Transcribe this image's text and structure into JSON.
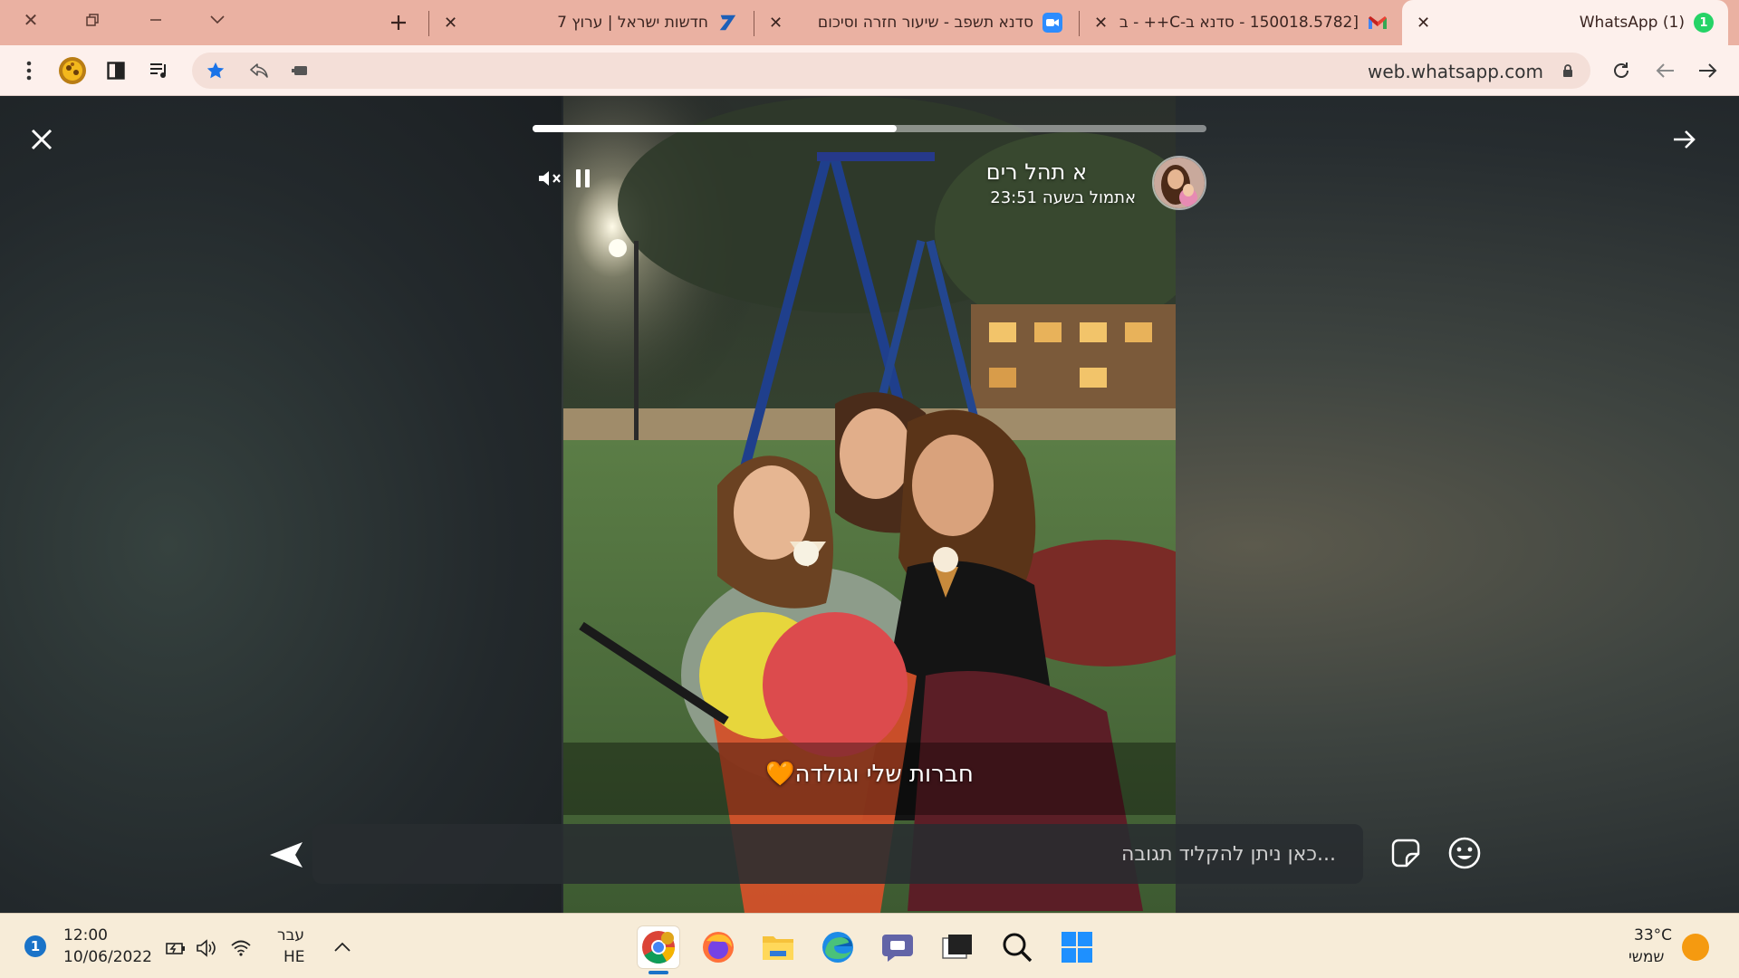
{
  "browser": {
    "tabs": [
      {
        "title": "(1) WhatsApp",
        "icon": "whatsapp-badge-icon",
        "badge": "1",
        "active": true
      },
      {
        "title": "[150018.5782 - סדנא ב-C++ - ב",
        "icon": "gmail-icon",
        "active": false
      },
      {
        "title": "סדנא תשפב - שיעור חזרה וסיכום",
        "icon": "zoom-icon",
        "active": false
      },
      {
        "title": "חדשות ישראל | ערוץ 7",
        "icon": "arutz7-icon",
        "active": false
      }
    ],
    "url": "web.whatsapp.com",
    "colors": {
      "tabstrip": "#eab1a2",
      "toolbar": "#fdf0ec"
    }
  },
  "story": {
    "poster_name": "א תהל רים",
    "posted_time": "אתמול בשעה 23:51",
    "progress": 0.54,
    "caption": "חברות שלי וגולדה🧡",
    "reply_placeholder": "...כאן ניתן להקליד תגובה"
  },
  "taskbar": {
    "notification_count": "1",
    "time": "12:00",
    "date": "10/06/2022",
    "lang_top": "עבר",
    "lang_bottom": "HE",
    "temperature": "33°C",
    "weather_label": "שמשי"
  }
}
